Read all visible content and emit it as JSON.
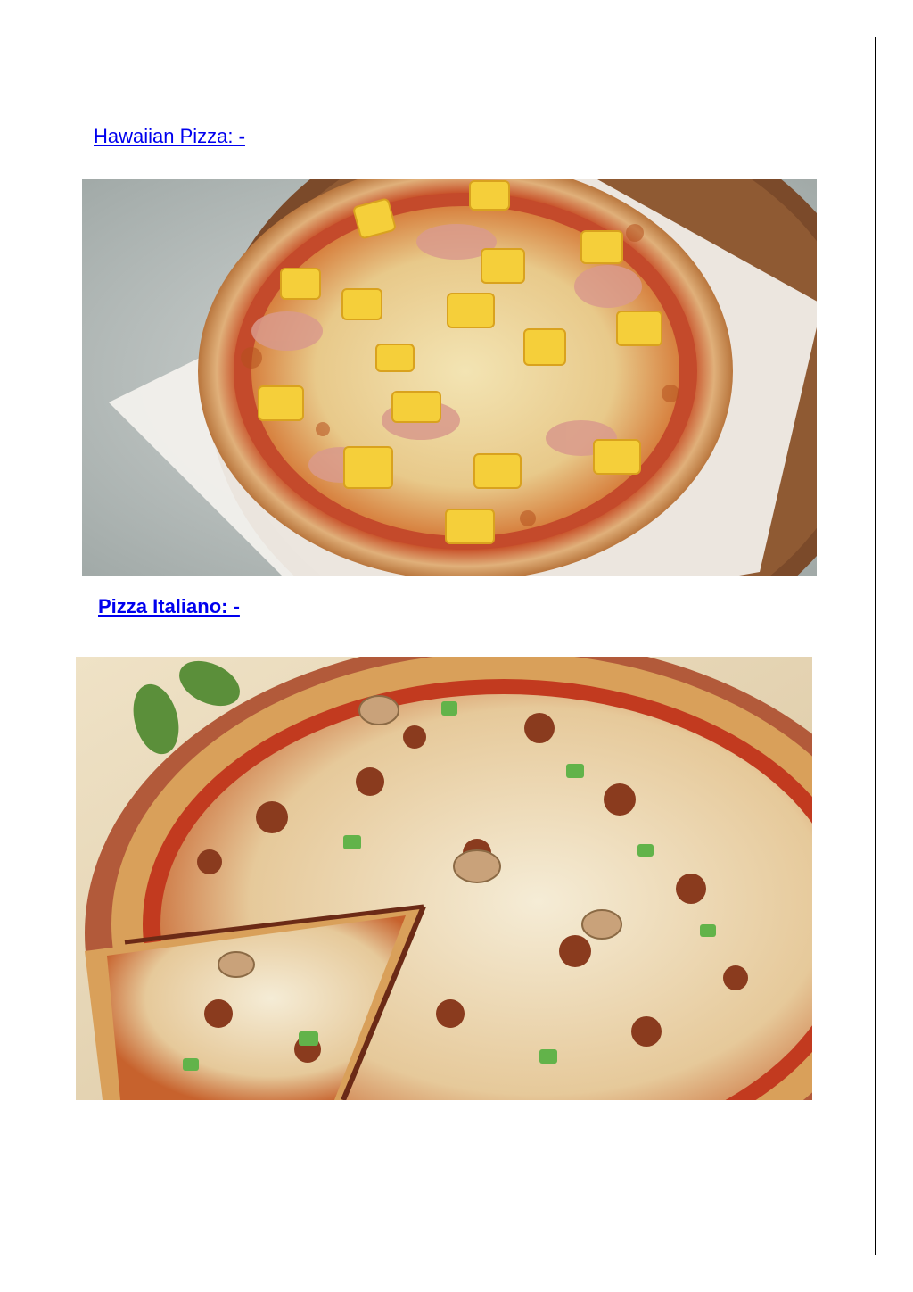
{
  "sections": [
    {
      "heading": "Hawaiian Pizza:",
      "heading_suffix": " -",
      "image_subject": "hawaiian-pizza"
    },
    {
      "heading": "Pizza Italiano: -",
      "heading_suffix": "",
      "image_subject": "italian-pizza"
    }
  ],
  "colors": {
    "link": "#0000ee",
    "border": "#000000"
  }
}
